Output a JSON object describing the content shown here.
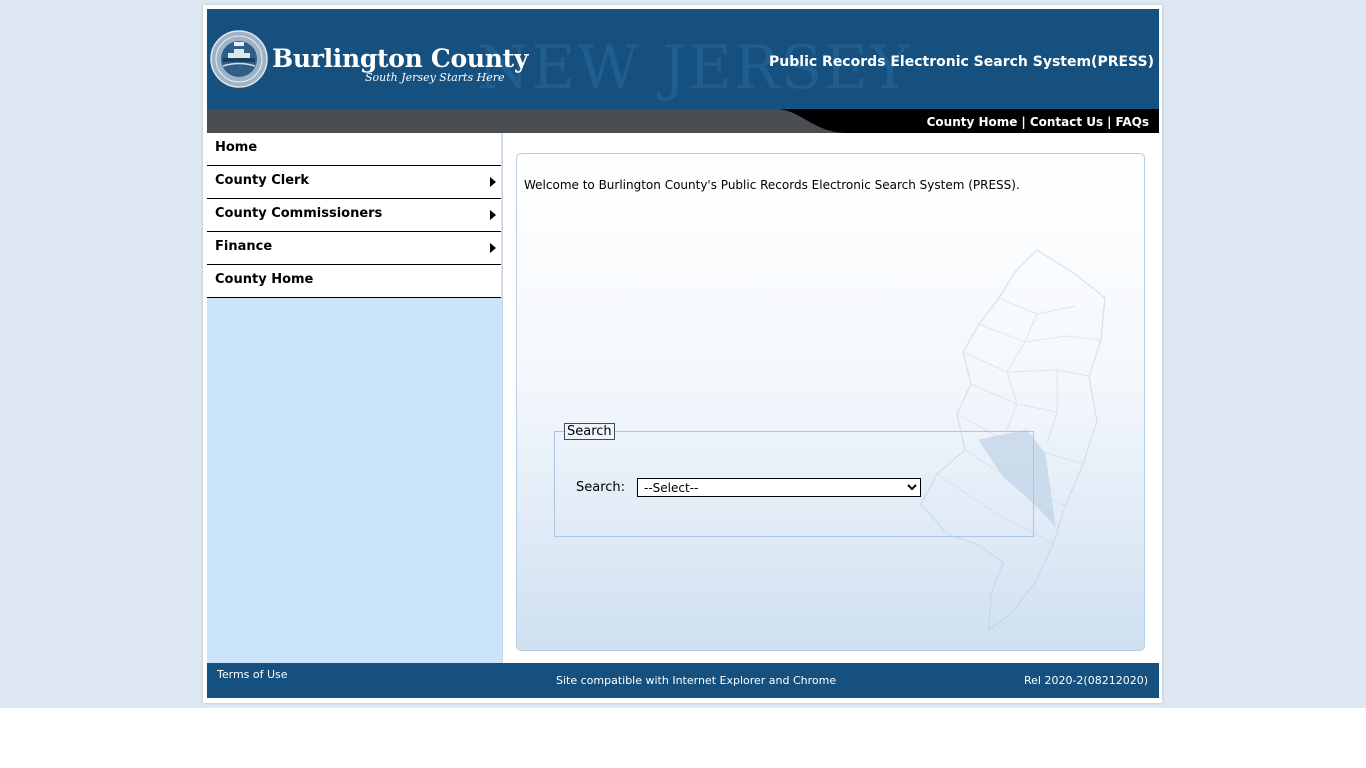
{
  "header": {
    "watermark": "NEW JERSEY",
    "brand_title": "Burlington County",
    "brand_subtitle": "South Jersey Starts Here",
    "system_title": "Public Records Electronic Search System(PRESS)"
  },
  "top_links": {
    "county_home": "County Home",
    "contact_us": "Contact Us",
    "faqs": "FAQs",
    "separator": "|"
  },
  "sidebar": {
    "items": [
      {
        "label": "Home",
        "has_submenu": false
      },
      {
        "label": "County Clerk",
        "has_submenu": true
      },
      {
        "label": "County Commissioners",
        "has_submenu": true
      },
      {
        "label": "Finance",
        "has_submenu": true
      },
      {
        "label": "County Home",
        "has_submenu": false
      }
    ]
  },
  "main": {
    "welcome": "Welcome to Burlington County's Public Records Electronic Search System (PRESS).",
    "search": {
      "legend": "Search",
      "label": "Search:",
      "selected": "--Select--"
    }
  },
  "footer": {
    "terms": "Terms of Use",
    "compatibility": "Site compatible with Internet Explorer and Chrome",
    "release": "Rel 2020-2(08212020)"
  },
  "colors": {
    "header_blue": "#15507e",
    "sidebar_blue": "#cce4fa",
    "page_background": "#dde8f3"
  }
}
